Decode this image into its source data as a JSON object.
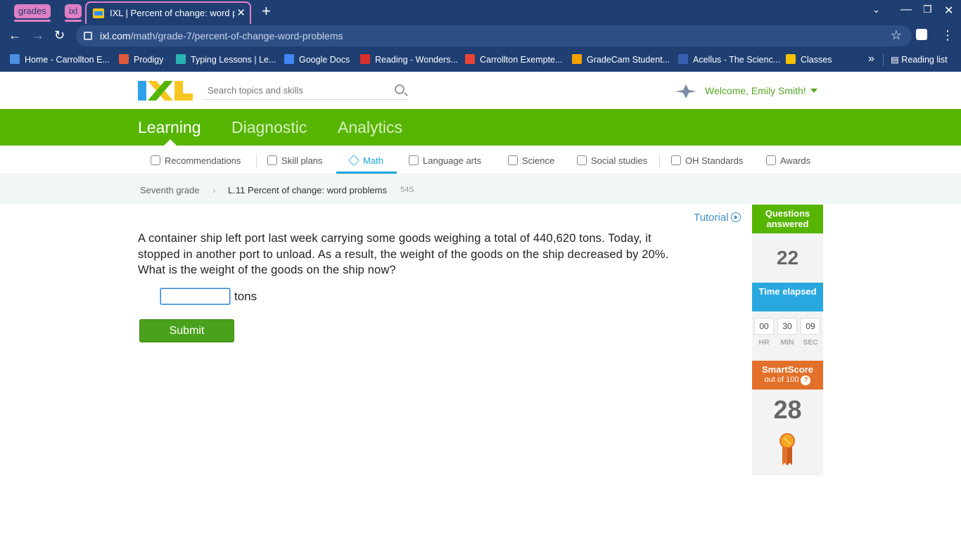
{
  "browser": {
    "tab_groups": [
      "grades",
      "ixl"
    ],
    "active_tab_title": "IXL | Percent of change: word problems",
    "new_tab": "+",
    "url_host": "ixl.com",
    "url_path": "/math/grade-7/percent-of-change-word-problems",
    "bookmarks": [
      {
        "label": "Home - Carrollton E...",
        "icon_color": "#4a90e2"
      },
      {
        "label": "Prodigy",
        "icon_color": "#e05a3a"
      },
      {
        "label": "Typing Lessons | Le...",
        "icon_color": "#2bb3b3"
      },
      {
        "label": "Google Docs",
        "icon_color": "#4285f4"
      },
      {
        "label": "Reading - Wonders...",
        "icon_color": "#d9302c"
      },
      {
        "label": "Carrollton Exempte...",
        "icon_color": "#ea4335"
      },
      {
        "label": "GradeCam Student...",
        "icon_color": "#f2a100"
      },
      {
        "label": "Acellus - The Scienc...",
        "icon_color": "#3a5fb0"
      },
      {
        "label": "Classes",
        "icon_color": "#f2c200"
      }
    ],
    "reading_list": "Reading list"
  },
  "header": {
    "search_placeholder": "Search topics and skills",
    "welcome": "Welcome, Emily Smith!"
  },
  "main_nav": [
    "Learning",
    "Diagnostic",
    "Analytics"
  ],
  "subject_nav": [
    "Recommendations",
    "Skill plans",
    "Math",
    "Language arts",
    "Science",
    "Social studies",
    "OH Standards",
    "Awards"
  ],
  "breadcrumb": {
    "grade": "Seventh grade",
    "skill": "L.11 Percent of change: word problems",
    "code": "54S"
  },
  "question": {
    "tutorial": "Tutorial",
    "text": "A container ship left port last week carrying some goods weighing a total of 440,620 tons. Today, it stopped in another port to unload. As a result, the weight of the goods on the ship decreased by 20%. What is the weight of the goods on the ship now?",
    "answer_value": "",
    "unit": "tons",
    "submit": "Submit"
  },
  "stats": {
    "questions_answered_label": "Questions answered",
    "questions_answered": "22",
    "time_elapsed_label": "Time elapsed",
    "hr": "00",
    "min": "30",
    "sec": "09",
    "hr_label": "HR",
    "min_label": "MIN",
    "sec_label": "SEC",
    "smartscore_label": "SmartScore",
    "smartscore_sub": "out of 100",
    "smartscore": "28"
  },
  "colors": {
    "chrome": "#1f3f73",
    "ixl_green": "#56b501",
    "accent_blue": "#29a8e0",
    "smartscore_orange": "#e3702a"
  }
}
